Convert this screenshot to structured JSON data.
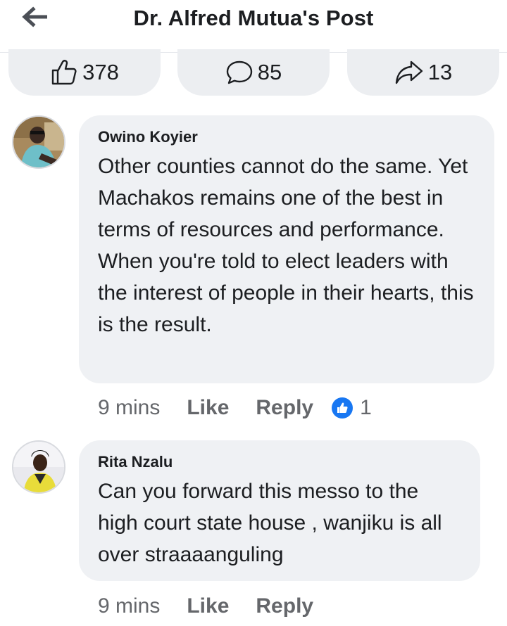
{
  "header": {
    "title": "Dr. Alfred Mutua's Post",
    "back_icon": "arrow-left-icon"
  },
  "stats": {
    "likes": "378",
    "comments": "85",
    "shares": "13"
  },
  "comments": [
    {
      "author": "Owino Koyier",
      "text": "Other counties cannot do the same. Yet Machakos remains one of the best in terms of resources and performance. When you're told to elect leaders with the interest of people in their hearts, this is the result.",
      "time": "9 mins",
      "like_label": "Like",
      "reply_label": "Reply",
      "reaction_count": "1"
    },
    {
      "author": "Rita Nzalu",
      "text": "Can you forward this messo to the high court state house , wanjiku is all over straaaanguling",
      "time": "9 mins",
      "like_label": "Like",
      "reply_label": "Reply"
    }
  ],
  "colors": {
    "accent": "#1877f2",
    "bubble": "#eff1f4",
    "muted_text": "#65676b"
  }
}
